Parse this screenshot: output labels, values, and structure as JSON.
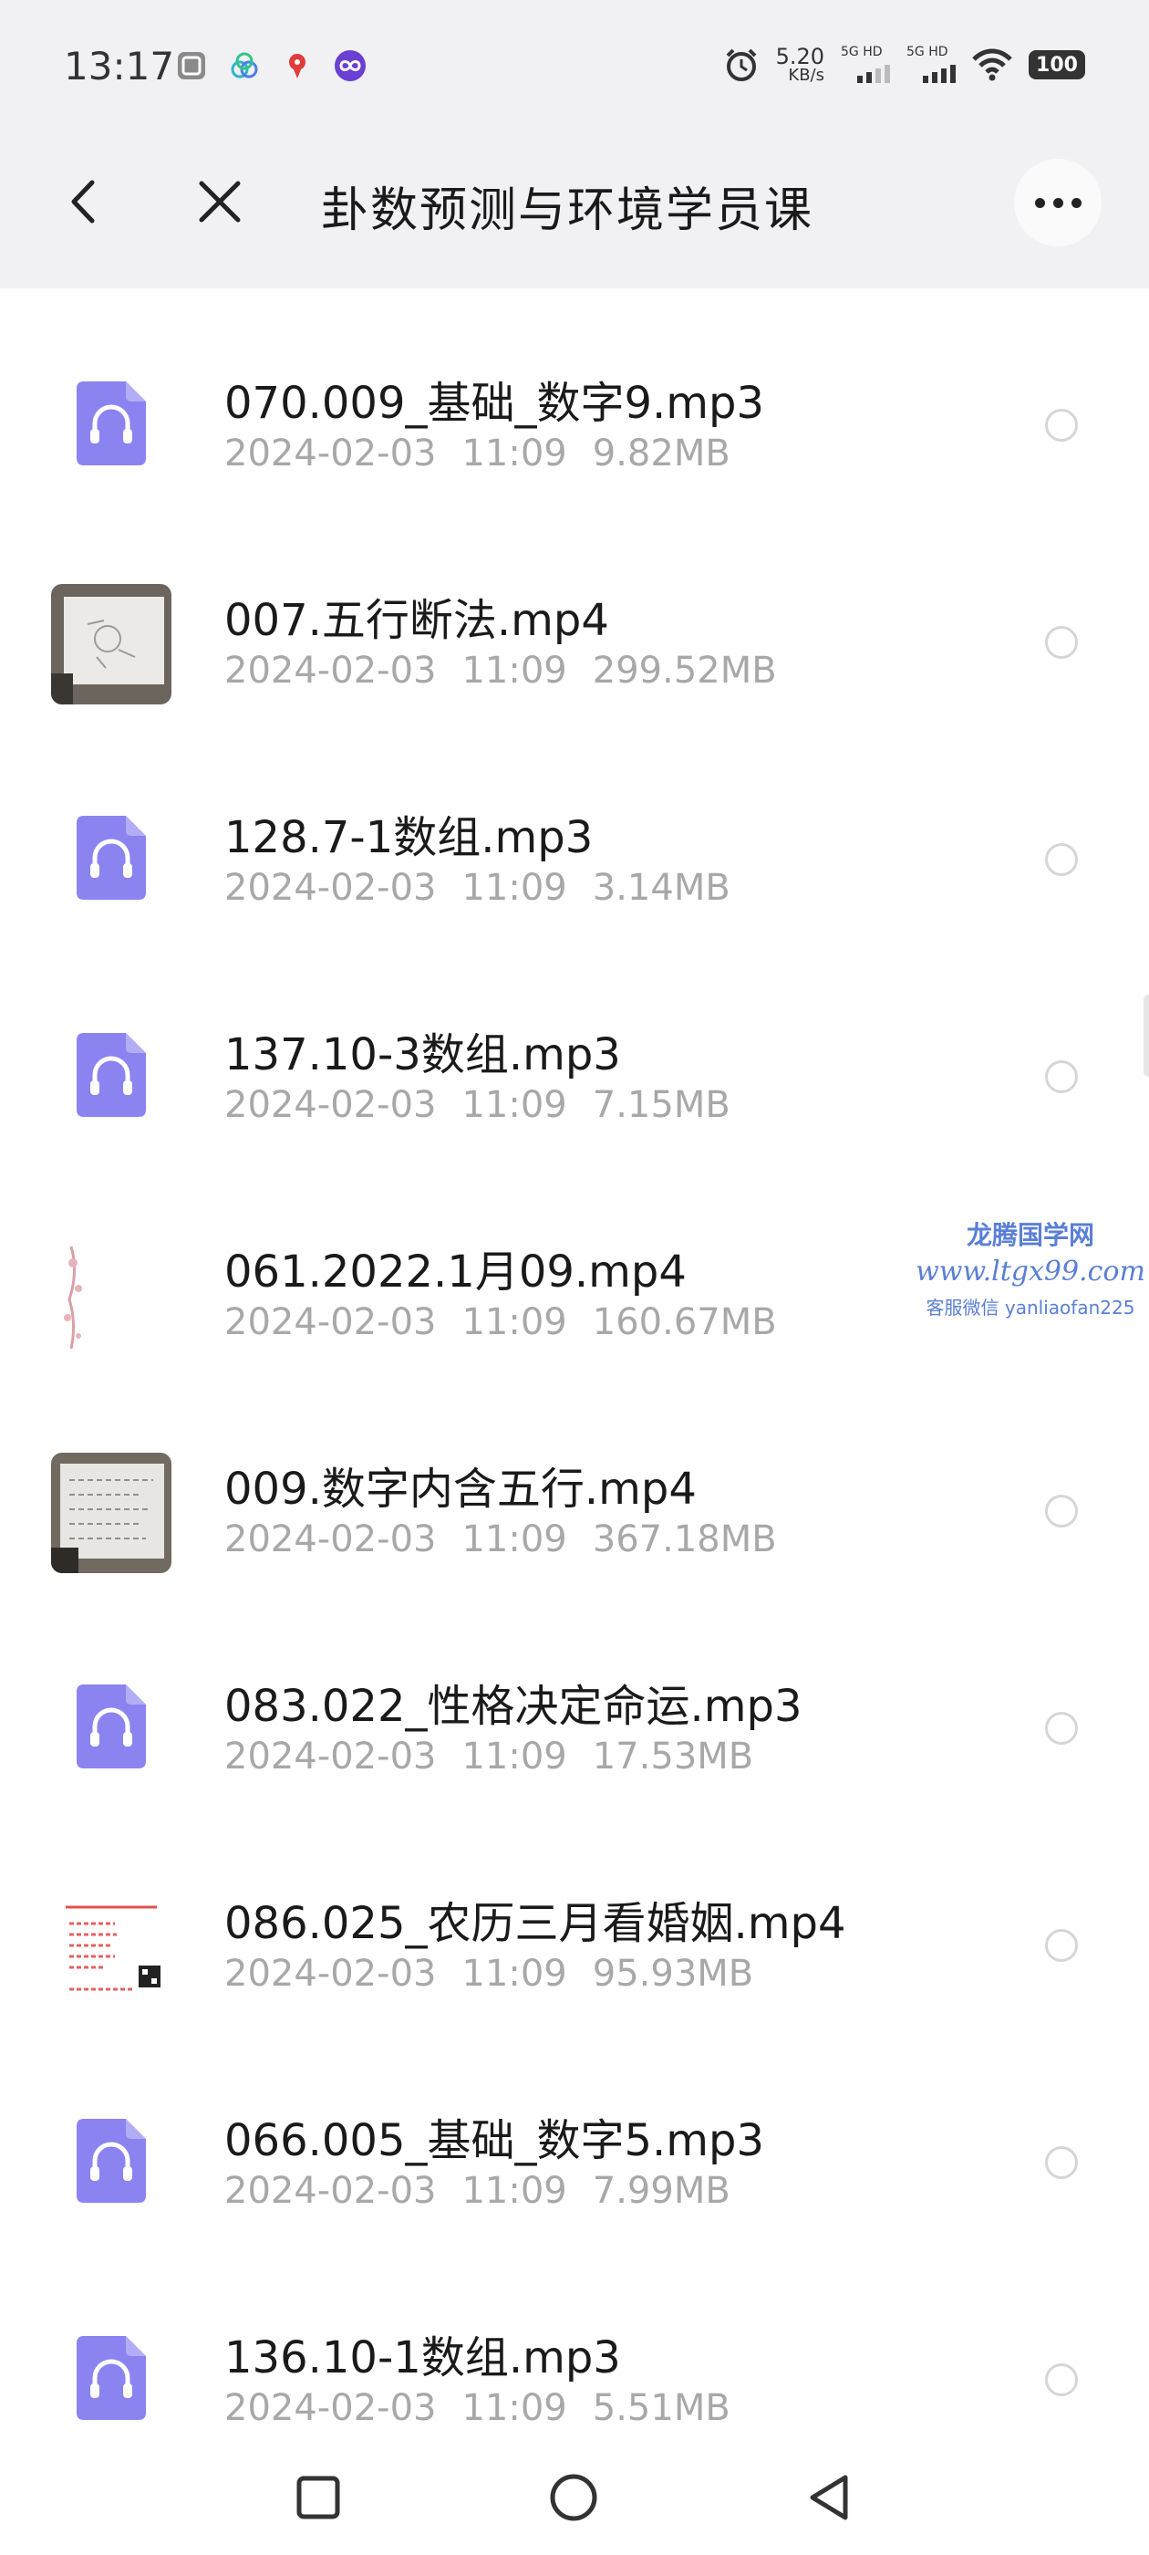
{
  "status_bar": {
    "time": "13:17",
    "net_speed": "5.20",
    "net_speed_unit": "KB/s",
    "signal_1": "5G HD",
    "signal_2": "5G HD",
    "battery": "100",
    "notification_icons": [
      "gallery-icon",
      "link-icon",
      "location-app-icon",
      "infinity-app-icon"
    ]
  },
  "header": {
    "title": "卦数预测与环境学员课"
  },
  "files": [
    {
      "name": "070.009_基础_数字9.mp3",
      "date": "2024-02-03",
      "time": "11:09",
      "size": "9.82MB",
      "type": "audio"
    },
    {
      "name": "007.五行断法.mp4",
      "date": "2024-02-03",
      "time": "11:09",
      "size": "299.52MB",
      "type": "video"
    },
    {
      "name": "128.7-1数组.mp3",
      "date": "2024-02-03",
      "time": "11:09",
      "size": "3.14MB",
      "type": "audio"
    },
    {
      "name": "137.10-3数组.mp3",
      "date": "2024-02-03",
      "time": "11:09",
      "size": "7.15MB",
      "type": "audio"
    },
    {
      "name": "061.2022.1月09.mp4",
      "date": "2024-02-03",
      "time": "11:09",
      "size": "160.67MB",
      "type": "video"
    },
    {
      "name": "009.数字内含五行.mp4",
      "date": "2024-02-03",
      "time": "11:09",
      "size": "367.18MB",
      "type": "video"
    },
    {
      "name": "083.022_性格决定命运.mp3",
      "date": "2024-02-03",
      "time": "11:09",
      "size": "17.53MB",
      "type": "audio"
    },
    {
      "name": "086.025_农历三月看婚姻.mp4",
      "date": "2024-02-03",
      "time": "11:09",
      "size": "95.93MB",
      "type": "video"
    },
    {
      "name": "066.005_基础_数字5.mp3",
      "date": "2024-02-03",
      "time": "11:09",
      "size": "7.99MB",
      "type": "audio"
    },
    {
      "name": "136.10-1数组.mp3",
      "date": "2024-02-03",
      "time": "11:09",
      "size": "5.51MB",
      "type": "audio"
    }
  ],
  "watermark": {
    "line1": "龙腾国学网",
    "line2": "www.ltgx99.com",
    "line3": "客服微信 yanliaofan225"
  },
  "colors": {
    "audio_icon": "#8b83f0",
    "header_bg": "#f1f1f3",
    "meta_text": "#a8a8a8",
    "watermark": "#5a7fd6"
  }
}
